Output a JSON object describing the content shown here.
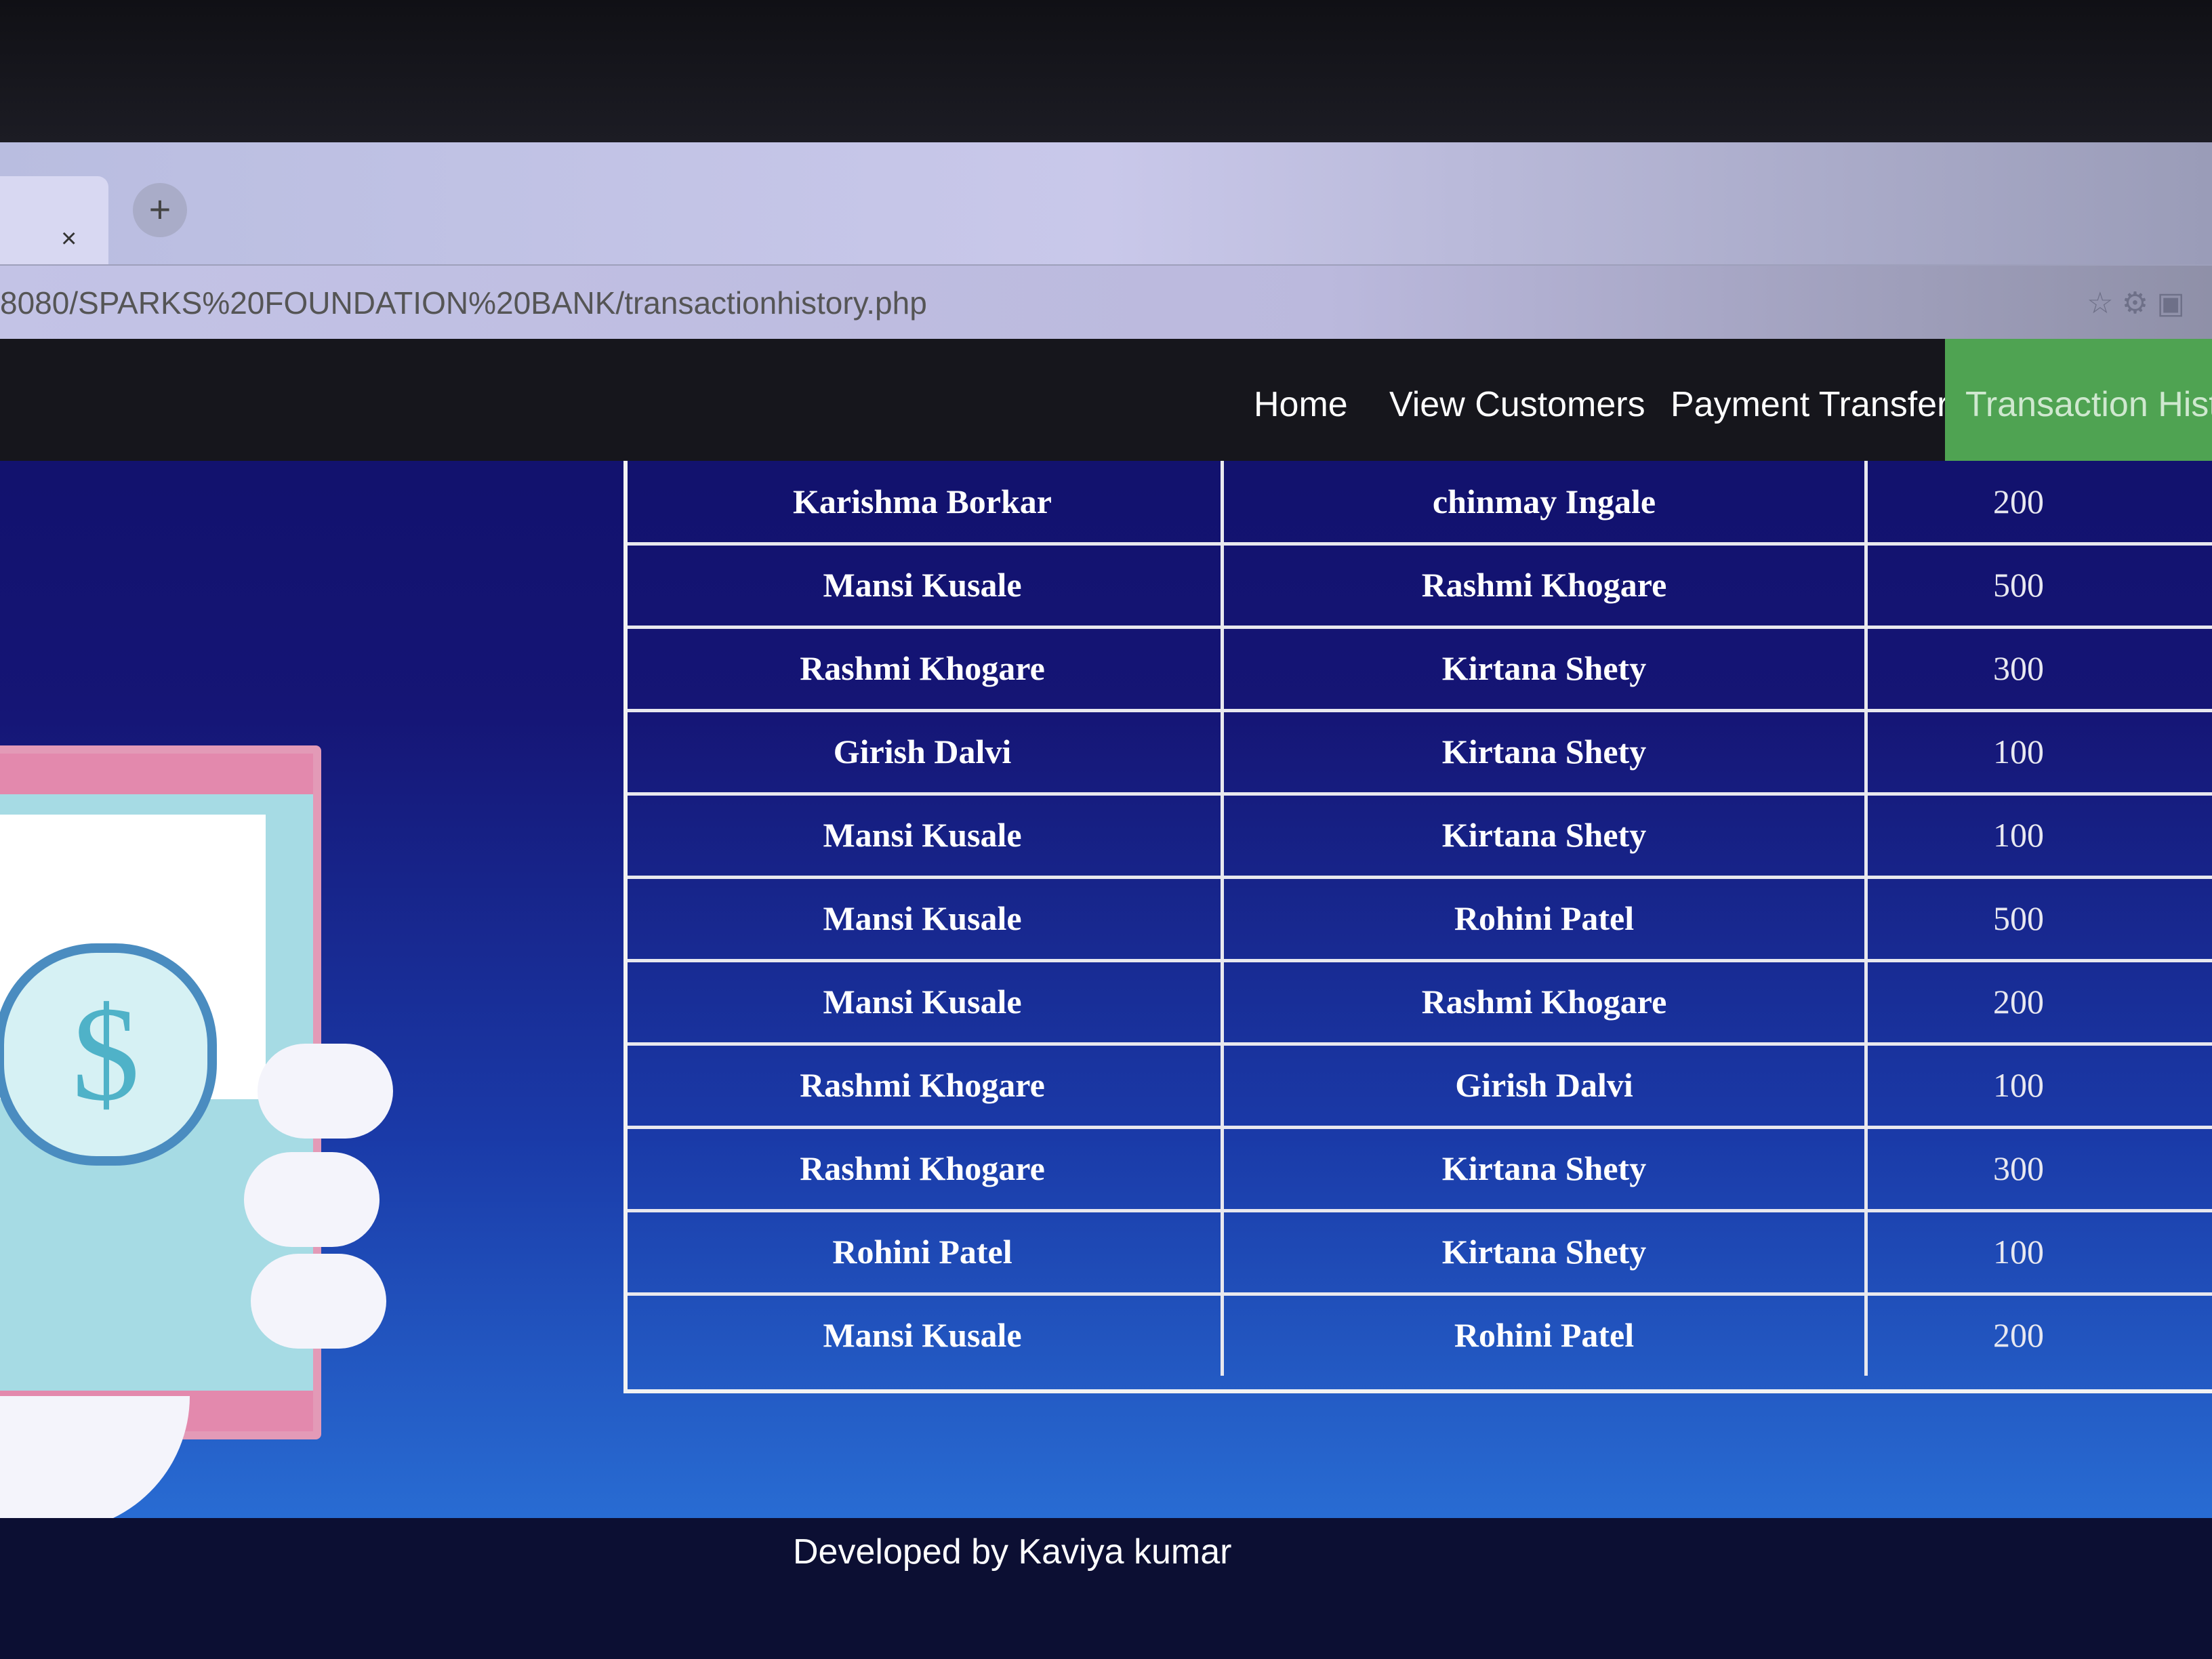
{
  "browser": {
    "tab_close": "×",
    "new_tab": "+",
    "url": "8080/SPARKS%20FOUNDATION%20BANK/transactionhistory.php"
  },
  "navbar": {
    "items": [
      {
        "label": "Home"
      },
      {
        "label": "View Customers"
      },
      {
        "label": "Payment Transfer"
      },
      {
        "label": "Transaction Histor"
      }
    ]
  },
  "transactions": [
    {
      "sender": "Karishma Borkar",
      "receiver": "chinmay Ingale",
      "amount": "200"
    },
    {
      "sender": "Mansi Kusale",
      "receiver": "Rashmi Khogare",
      "amount": "500"
    },
    {
      "sender": "Rashmi Khogare",
      "receiver": "Kirtana Shety",
      "amount": "300"
    },
    {
      "sender": "Girish Dalvi",
      "receiver": "Kirtana Shety",
      "amount": "100"
    },
    {
      "sender": "Mansi Kusale",
      "receiver": "Kirtana Shety",
      "amount": "100"
    },
    {
      "sender": "Mansi Kusale",
      "receiver": "Rohini Patel",
      "amount": "500"
    },
    {
      "sender": "Mansi Kusale",
      "receiver": "Rashmi Khogare",
      "amount": "200"
    },
    {
      "sender": "Rashmi Khogare",
      "receiver": "Girish Dalvi",
      "amount": "100"
    },
    {
      "sender": "Rashmi Khogare",
      "receiver": "Kirtana Shety",
      "amount": "300"
    },
    {
      "sender": "Rohini Patel",
      "receiver": "Kirtana Shety",
      "amount": "100"
    },
    {
      "sender": "Mansi Kusale",
      "receiver": "Rohini Patel",
      "amount": "200"
    }
  ],
  "illustration": {
    "coin_symbol": "$"
  },
  "footer": {
    "text": "Developed by Kaviya kumar"
  },
  "colors": {
    "nav_active": "#4fa352",
    "navbar": "#16161c",
    "page_top": "#10106a",
    "page_bottom": "#2a72d8"
  }
}
